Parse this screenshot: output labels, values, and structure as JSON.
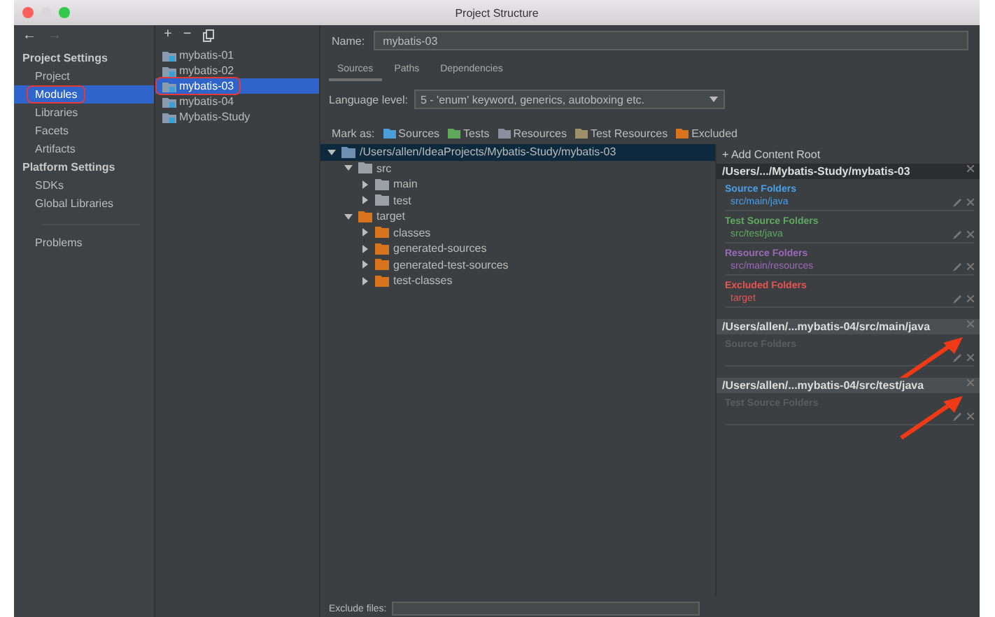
{
  "window": {
    "title": "Project Structure"
  },
  "nav": {
    "back": "←",
    "forward": "→"
  },
  "sidebar": {
    "sections": [
      {
        "heading": "Project Settings",
        "items": [
          {
            "label": "Project",
            "selected": false,
            "highlighted": false
          },
          {
            "label": "Modules",
            "selected": true,
            "highlighted": true
          },
          {
            "label": "Libraries",
            "selected": false,
            "highlighted": false
          },
          {
            "label": "Facets",
            "selected": false,
            "highlighted": false
          },
          {
            "label": "Artifacts",
            "selected": false,
            "highlighted": false
          }
        ]
      },
      {
        "heading": "Platform Settings",
        "items": [
          {
            "label": "SDKs",
            "selected": false,
            "highlighted": false
          },
          {
            "label": "Global Libraries",
            "selected": false,
            "highlighted": false
          }
        ]
      }
    ],
    "bottom_items": [
      {
        "label": "Problems",
        "selected": false,
        "highlighted": false
      }
    ]
  },
  "module_toolbar": {
    "add": "+",
    "remove": "−"
  },
  "modules": [
    {
      "label": "mybatis-01",
      "selected": false,
      "highlighted": false
    },
    {
      "label": "mybatis-02",
      "selected": false,
      "highlighted": false
    },
    {
      "label": "mybatis-03",
      "selected": true,
      "highlighted": true
    },
    {
      "label": "mybatis-04",
      "selected": false,
      "highlighted": false
    },
    {
      "label": "Mybatis-Study",
      "selected": false,
      "highlighted": false
    }
  ],
  "name_field": {
    "label": "Name:",
    "value": "mybatis-03"
  },
  "tabs": [
    {
      "label": "Sources",
      "selected": true
    },
    {
      "label": "Paths",
      "selected": false
    },
    {
      "label": "Dependencies",
      "selected": false
    }
  ],
  "language_level": {
    "label": "Language level:",
    "value": "5 - 'enum' keyword, generics, autoboxing etc."
  },
  "mark_as": {
    "label": "Mark as:",
    "buttons": [
      {
        "label": "Sources",
        "color": "#4a9fd8"
      },
      {
        "label": "Tests",
        "color": "#62a85a"
      },
      {
        "label": "Resources",
        "color": "#8a8fa0"
      },
      {
        "label": "Test Resources",
        "color": "#a0906a"
      },
      {
        "label": "Excluded",
        "color": "#d8731e"
      }
    ]
  },
  "tree": [
    {
      "label": "/Users/allen/IdeaProjects/Mybatis-Study/mybatis-03",
      "kind": "module",
      "expanded": true,
      "selected": true,
      "children": [
        {
          "label": "src",
          "kind": "plain",
          "expanded": true,
          "selected": false,
          "children": [
            {
              "label": "main",
              "kind": "plain",
              "expanded": false,
              "selected": false
            },
            {
              "label": "test",
              "kind": "plain",
              "expanded": false,
              "selected": false
            }
          ]
        },
        {
          "label": "target",
          "kind": "excluded",
          "expanded": true,
          "selected": false,
          "children": [
            {
              "label": "classes",
              "kind": "excluded",
              "expanded": false,
              "selected": false
            },
            {
              "label": "generated-sources",
              "kind": "excluded",
              "expanded": false,
              "selected": false
            },
            {
              "label": "generated-test-sources",
              "kind": "excluded",
              "expanded": false,
              "selected": false
            },
            {
              "label": "test-classes",
              "kind": "excluded",
              "expanded": false,
              "selected": false
            }
          ]
        }
      ]
    }
  ],
  "content_roots_panel": {
    "add_button": "+ Add Content Root",
    "roots": [
      {
        "path": "/Users/.../Mybatis-Study/mybatis-03",
        "disabled": false,
        "groups": [
          {
            "title": "Source Folders",
            "color": "#4a9fe8",
            "entries": [
              "src/main/java"
            ]
          },
          {
            "title": "Test Source Folders",
            "color": "#5fa85f",
            "entries": [
              "src/test/java"
            ]
          },
          {
            "title": "Resource Folders",
            "color": "#9a6ab8",
            "entries": [
              "src/main/resources"
            ]
          },
          {
            "title": "Excluded Folders",
            "color": "#e85454",
            "entries": [
              "target"
            ]
          }
        ]
      },
      {
        "path": "/Users/allen/...mybatis-04/src/main/java",
        "disabled": true,
        "pointed": true,
        "groups": [
          {
            "title": "Source Folders"
          }
        ]
      },
      {
        "path": "/Users/allen/...mybatis-04/src/test/java",
        "disabled": true,
        "pointed": true,
        "groups": [
          {
            "title": "Test Source Folders"
          }
        ]
      }
    ]
  },
  "exclude_files": {
    "label": "Exclude files:"
  }
}
